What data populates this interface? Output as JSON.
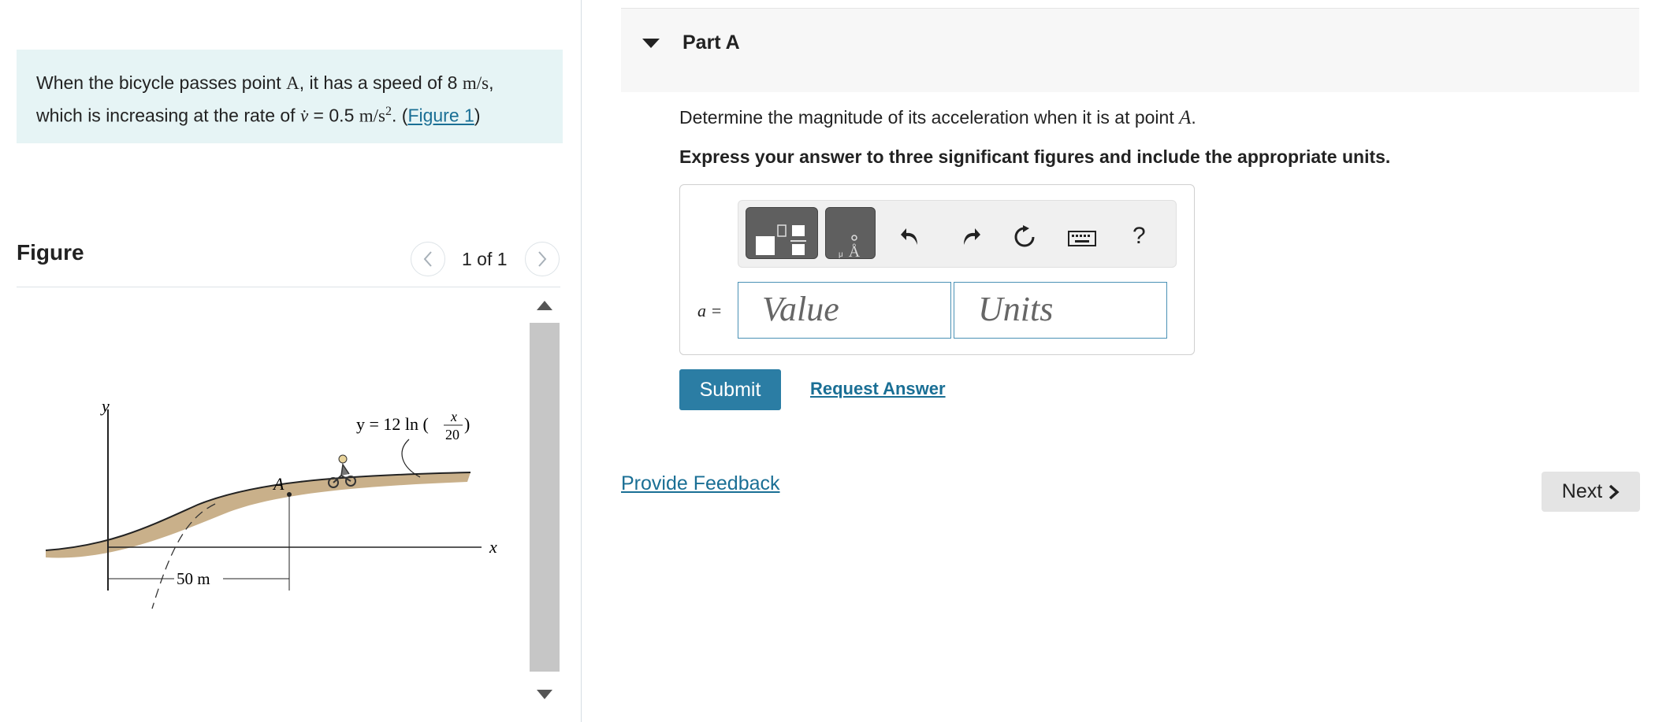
{
  "problem": {
    "text_1": "When the bicycle passes point ",
    "point": "A",
    "text_2": ", it has a speed of 8 ",
    "speed_unit": "m/s",
    "text_3": ",",
    "text_4": "which is increasing at the rate of ",
    "vdot": "v̇",
    "text_5": " = 0.5 ",
    "accel_unit": "m/s",
    "accel_exp": "2",
    "text_6": ". (",
    "figure_link": "Figure 1",
    "text_7": ")"
  },
  "figure_panel": {
    "label": "Figure",
    "count": "1 of 1",
    "prev_icon": "chevron-left-icon",
    "next_icon": "chevron-right-icon",
    "drawing": {
      "y_axis": "y",
      "x_axis": "x",
      "point": "A",
      "equation_prefix": "y = 12 ln (",
      "fraction_num": "x",
      "fraction_den": "20",
      "equation_suffix": ")",
      "dimension": "50 m"
    }
  },
  "part": {
    "title": "Part A",
    "question_prefix": "Determine the magnitude of its acceleration when it is at point ",
    "question_point": "A",
    "question_suffix": ".",
    "instruction": "Express your answer to three significant figures and include the appropriate units.",
    "toolbar": {
      "icons": [
        "templates-icon",
        "units-icon",
        "undo-icon",
        "redo-icon",
        "reset-icon",
        "keyboard-icon",
        "help-icon"
      ],
      "help_label": "?"
    },
    "variable_label": "a =",
    "value_placeholder": "Value",
    "units_placeholder": "Units",
    "submit_label": "Submit",
    "request_answer_label": "Request Answer"
  },
  "footer": {
    "feedback_label": "Provide Feedback",
    "next_label": "Next",
    "next_icon": "chevron-right-icon"
  }
}
